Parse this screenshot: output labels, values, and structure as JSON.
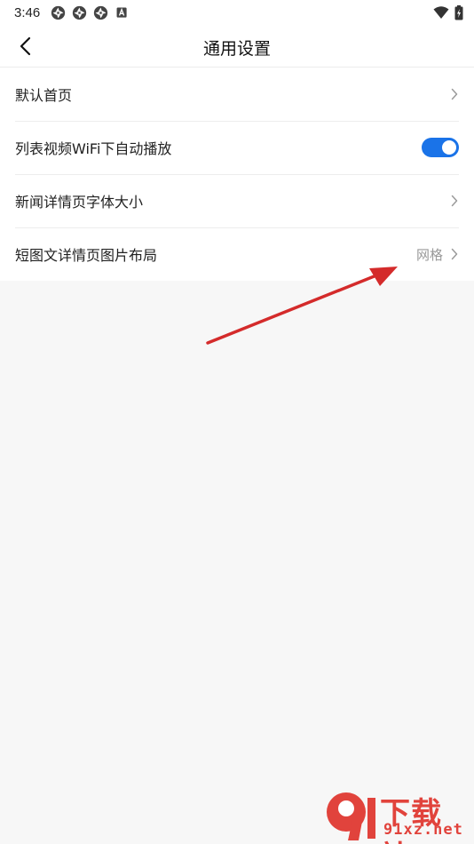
{
  "status_bar": {
    "time": "3:46",
    "notification_icons": [
      "pinwheel-icon",
      "pinwheel-icon",
      "pinwheel-icon",
      "a-badge-icon"
    ],
    "right_icons": [
      "wifi-icon",
      "battery-charging-icon"
    ]
  },
  "header": {
    "back_icon": "chevron-left-icon",
    "title": "通用设置"
  },
  "settings": {
    "items": [
      {
        "label": "默认首页",
        "control": "chevron"
      },
      {
        "label": "列表视频WiFi下自动播放",
        "control": "toggle",
        "toggle_on": true
      },
      {
        "label": "新闻详情页字体大小",
        "control": "chevron"
      },
      {
        "label": "短图文详情页图片布局",
        "value": "网格",
        "control": "chevron"
      }
    ]
  },
  "watermark": {
    "logo_text": "9",
    "title": "下载站",
    "domain": "91xz.net"
  },
  "colors": {
    "accent": "#1a73e8",
    "annotation_arrow": "#d42b2b",
    "watermark": "#e1433c",
    "page_background": "#f7f7f7"
  }
}
